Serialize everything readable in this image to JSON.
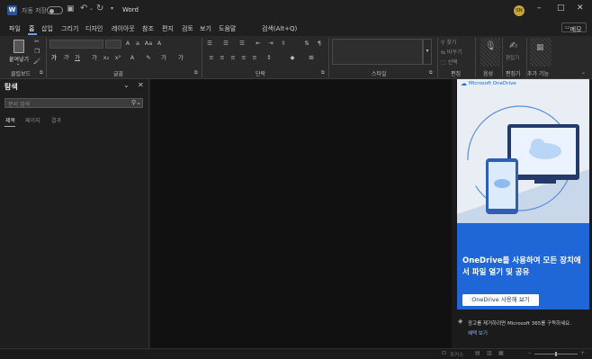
{
  "titlebar": {
    "autosave_label": "자동 저장",
    "app_name": "Word",
    "avatar_initials": "SN",
    "feedback_label": "메모"
  },
  "search": {
    "placeholder": "검색(Alt+Q)"
  },
  "menu": {
    "tabs": [
      {
        "label": "파일"
      },
      {
        "label": "홈"
      },
      {
        "label": "삽입"
      },
      {
        "label": "그리기"
      },
      {
        "label": "디자인"
      },
      {
        "label": "레이아웃"
      },
      {
        "label": "참조"
      },
      {
        "label": "편지"
      },
      {
        "label": "검토"
      },
      {
        "label": "보기"
      },
      {
        "label": "도움말"
      }
    ]
  },
  "ribbon": {
    "paste_label": "붙여넣기",
    "groups": {
      "clipboard": "클립보드",
      "font": "글꼴",
      "paragraph": "단락",
      "styles": "스타일",
      "editing": "편집",
      "voice": "음성",
      "editor": "편집기",
      "addins": "추가 기능"
    },
    "editing_items": [
      "찾기",
      "바꾸기",
      "선택"
    ],
    "big_buttons": {
      "voice": "받아쓰기",
      "editor": "편집기",
      "addins": "추가 기능"
    }
  },
  "nav_pane": {
    "title": "탐색",
    "search_placeholder": "문서 검색",
    "tabs": [
      {
        "label": "제목"
      },
      {
        "label": "페이지"
      },
      {
        "label": "결과"
      }
    ]
  },
  "ad_pane": {
    "brand": "Microsoft OneDrive",
    "headline": "OneDrive를 사용하여 모든 장치에서 파일 열기 및 공유",
    "cta": "OneDrive 사용해 보기",
    "footer_text": "광고를 제거하려면 Microsoft 365를 구독하세요.",
    "footer_link": "혜택 보기"
  },
  "statusbar": {
    "focus_label": "포커스"
  },
  "colors": {
    "accent": "#2b579a",
    "onedrive_blue": "#1f67d6",
    "ad_panel_bg": "#e9eef5",
    "avatar": "#c8a53a"
  }
}
